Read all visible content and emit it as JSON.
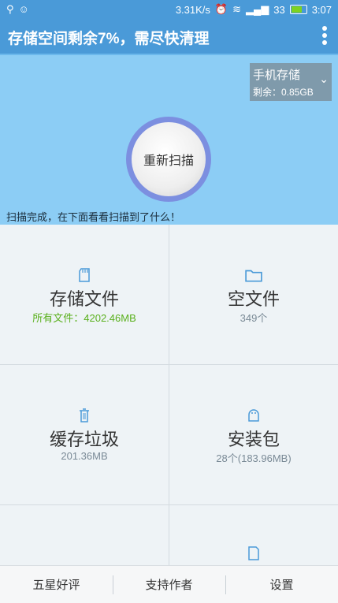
{
  "status_bar": {
    "network_speed": "3.31K/s",
    "signal": "33",
    "time": "3:07",
    "icons": [
      "usb-icon",
      "smiley-icon",
      "alarm-icon",
      "wifi-icon",
      "signal-icon",
      "battery-icon"
    ]
  },
  "app_bar": {
    "title": "存储空间剩余7%，需尽快清理"
  },
  "hero": {
    "storage_type": "手机存储",
    "remaining": "剩余：0.85GB",
    "scan_button": "重新扫描",
    "status_text": "扫描完成，在下面看看扫描到了什么！"
  },
  "grid": [
    {
      "title": "存储文件",
      "sub": "所有文件：4202.46MB",
      "icon": "sd-card-icon",
      "accent": "#5ab01d"
    },
    {
      "title": "空文件",
      "sub": "349个",
      "icon": "folder-icon"
    },
    {
      "title": "缓存垃圾",
      "sub": "201.36MB",
      "icon": "trash-icon"
    },
    {
      "title": "安装包",
      "sub": "28个(183.96MB)",
      "icon": "android-apk-icon"
    },
    {
      "title": "",
      "sub": "",
      "icon": ""
    },
    {
      "title": "",
      "sub": "",
      "icon": "apk-file-icon"
    }
  ],
  "bottom_bar": {
    "rate": "五星好评",
    "support": "支持作者",
    "settings": "设置"
  },
  "colors": {
    "primary": "#4a9ad8",
    "hero_bg": "#8ccdf5",
    "ring": "#7c8fe0"
  }
}
